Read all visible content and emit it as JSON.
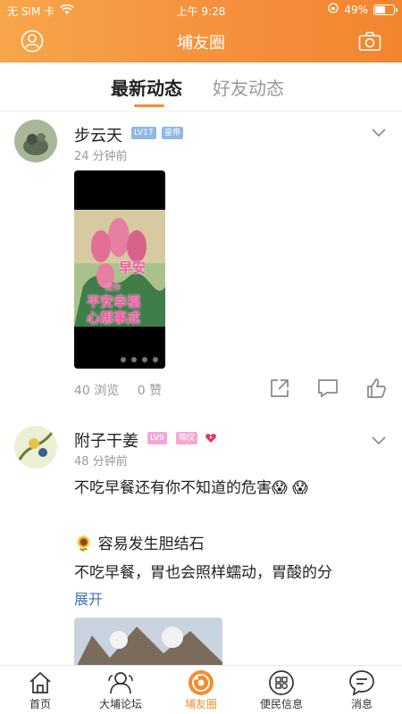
{
  "status": {
    "carrier": "无 SIM 卡",
    "time": "上午 9:28",
    "battery": "49%"
  },
  "header": {
    "title": "埔友圈"
  },
  "tabs": [
    {
      "label": "最新动态"
    },
    {
      "label": "好友动态"
    }
  ],
  "posts": [
    {
      "user": "步云天",
      "level": "LV17",
      "title_badge": "皇帝",
      "time": "24 分钟前",
      "image_caption": [
        "早安",
        "祝你",
        "平安幸福",
        "心想事成"
      ],
      "views": "40 浏览",
      "likes": "0 赞"
    },
    {
      "user": "附子干姜",
      "level": "LV9",
      "title_badge": "锦仪",
      "time": "48 分钟前",
      "line1": "不吃早餐还有你不知道的危害😱 😱",
      "line2": "🌻 容易发生胆结石",
      "line3": "不吃早餐，胃也会照样蠕动，胃酸的分",
      "expand": "展开"
    }
  ],
  "bottomnav": [
    {
      "label": "首页"
    },
    {
      "label": "大埔论坛"
    },
    {
      "label": "埔友圈"
    },
    {
      "label": "便民信息"
    },
    {
      "label": "消息"
    }
  ],
  "colors": {
    "accent": "#f28d32",
    "link": "#3a74b8",
    "level_badge": "#8fb8e8",
    "title_badge": "#8fb8e8",
    "lv9_badge": "#f3a7d6"
  }
}
